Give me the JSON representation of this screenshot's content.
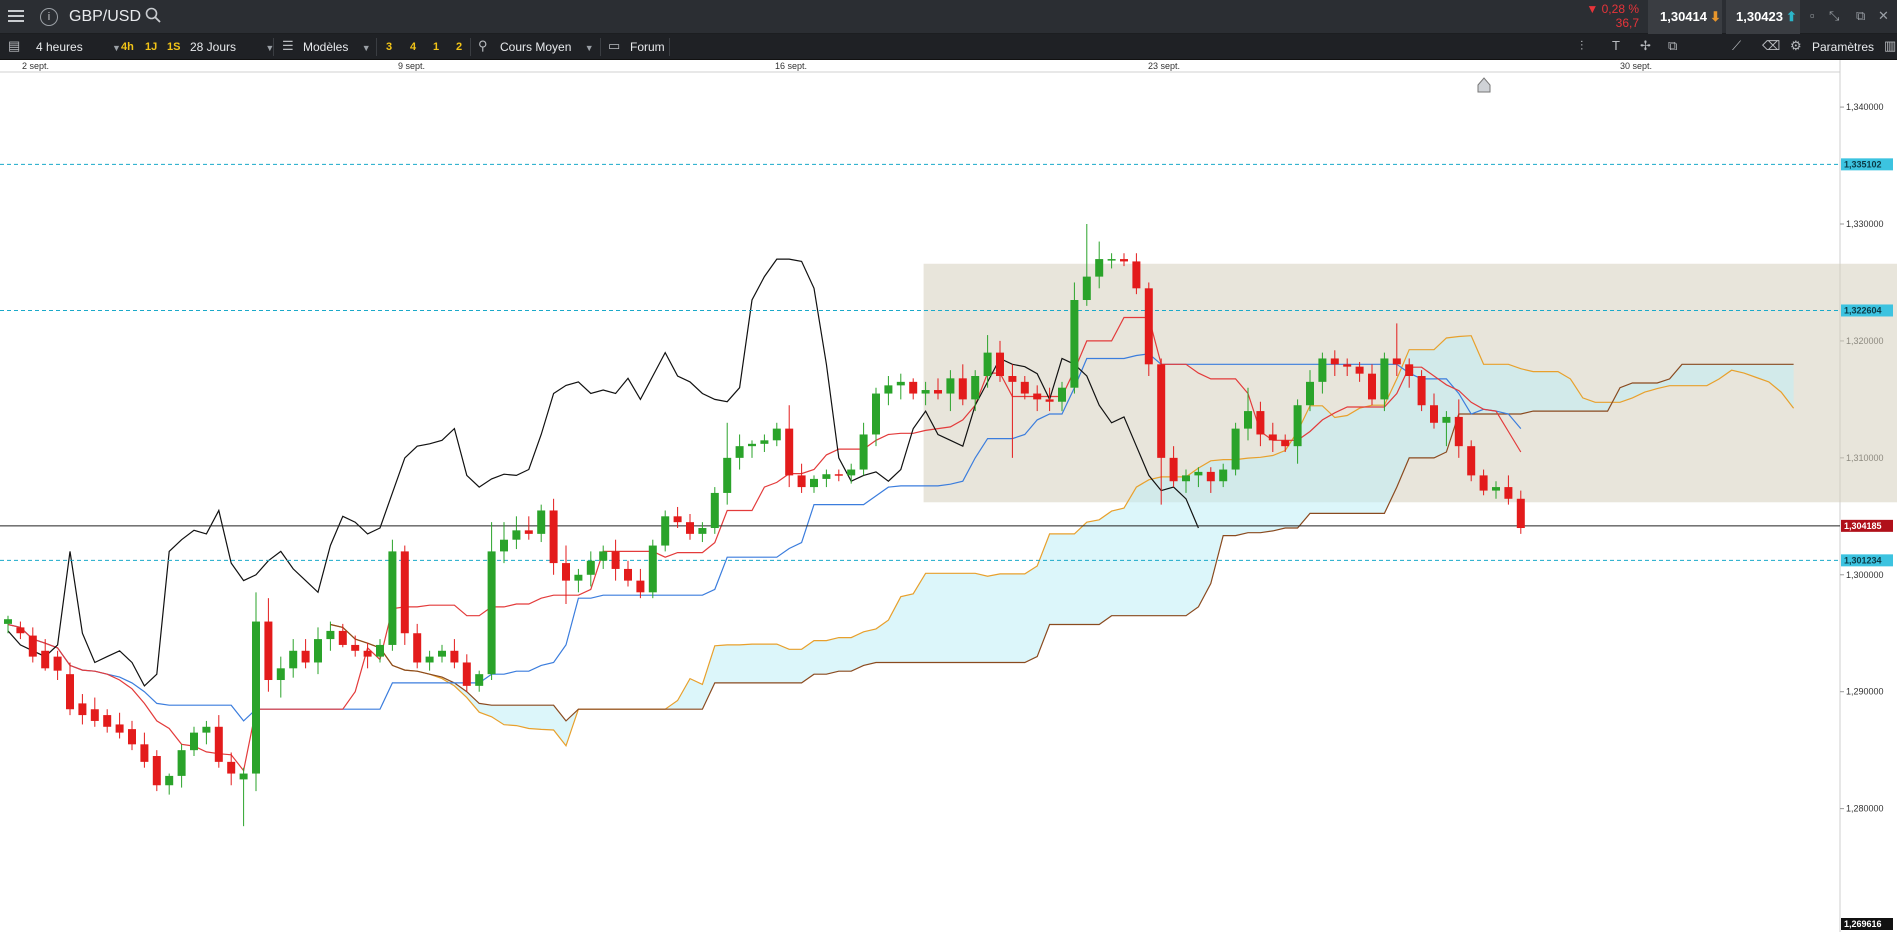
{
  "app": {
    "symbol": "GBP/USD"
  },
  "quote": {
    "change_pct": "▼ 0,28 %",
    "change_pts": "36,7",
    "bid": "1,30414",
    "ask": "1,30423"
  },
  "toolbar": {
    "timeframe": "4 heures",
    "quick_frames": [
      "4h",
      "1J",
      "1S"
    ],
    "range": "28 Jours",
    "models": "Modèles",
    "presets": [
      "3",
      "4",
      "1",
      "2"
    ],
    "price_type": "Cours Moyen",
    "forum": "Forum",
    "settings": "Paramètres"
  },
  "icons": {
    "menu": "hamburger-menu-icon",
    "info": "info-icon",
    "search": "search-icon",
    "bid_trend": "arrow-down-icon",
    "ask_trend": "arrow-up-icon",
    "restore": "restore-icon",
    "collapse": "collapse-icon",
    "popout": "popout-icon",
    "close": "close-icon",
    "settings": "gear-icon",
    "list": "list-icon",
    "chart_type": "candlestick-icon",
    "draw": "draw-line-icon"
  },
  "chart_data": {
    "type": "candlestick",
    "x_ticks": [
      "2 sept.",
      "9 sept.",
      "16 sept.",
      "23 sept.",
      "30 sept."
    ],
    "y_ticks": [
      "1,340000",
      "1,330000",
      "1,320000",
      "1,310000",
      "1,300000",
      "1,290000",
      "1,280000"
    ],
    "ylim": [
      1.26962,
      1.343
    ],
    "levels": [
      {
        "label": "1,335102",
        "value": 1.335102,
        "style": "dashed",
        "color": "#1aa9c9"
      },
      {
        "label": "1,322604",
        "value": 1.322604,
        "style": "dashed",
        "color": "#1aa9c9"
      },
      {
        "label": "1,304185",
        "value": 1.304185,
        "style": "solid",
        "color": "#222222",
        "tag_color": "#b0101a"
      },
      {
        "label": "1,301234",
        "value": 1.301234,
        "style": "dashed",
        "color": "#1aa9c9"
      }
    ],
    "bottom_label": "1,269616",
    "range_box": {
      "from_index": 74,
      "to_index": 176,
      "top": 1.3266,
      "bottom": 1.3062
    },
    "candles": [
      [
        1.2958,
        1.2965,
        1.295,
        1.2962
      ],
      [
        1.2955,
        1.296,
        1.2945,
        1.295
      ],
      [
        1.2948,
        1.2955,
        1.2925,
        1.293
      ],
      [
        1.2935,
        1.2945,
        1.2918,
        1.292
      ],
      [
        1.293,
        1.2935,
        1.291,
        1.2918
      ],
      [
        1.2915,
        1.2925,
        1.288,
        1.2885
      ],
      [
        1.289,
        1.2898,
        1.2872,
        1.288
      ],
      [
        1.2885,
        1.2895,
        1.287,
        1.2875
      ],
      [
        1.288,
        1.2885,
        1.2865,
        1.287
      ],
      [
        1.2872,
        1.2882,
        1.286,
        1.2865
      ],
      [
        1.2868,
        1.2875,
        1.285,
        1.2855
      ],
      [
        1.2855,
        1.2865,
        1.2835,
        1.284
      ],
      [
        1.2845,
        1.285,
        1.2815,
        1.282
      ],
      [
        1.282,
        1.283,
        1.2812,
        1.2828
      ],
      [
        1.2828,
        1.2855,
        1.2818,
        1.285
      ],
      [
        1.285,
        1.287,
        1.2845,
        1.2865
      ],
      [
        1.2865,
        1.2875,
        1.2855,
        1.287
      ],
      [
        1.287,
        1.288,
        1.2835,
        1.284
      ],
      [
        1.284,
        1.2848,
        1.282,
        1.283
      ],
      [
        1.2825,
        1.2835,
        1.2785,
        1.283
      ],
      [
        1.283,
        1.2985,
        1.2815,
        1.296
      ],
      [
        1.296,
        1.298,
        1.29,
        1.291
      ],
      [
        1.291,
        1.293,
        1.2895,
        1.292
      ],
      [
        1.292,
        1.2945,
        1.2912,
        1.2935
      ],
      [
        1.2935,
        1.2945,
        1.292,
        1.2925
      ],
      [
        1.2925,
        1.2955,
        1.2915,
        1.2945
      ],
      [
        1.2945,
        1.296,
        1.2935,
        1.2952
      ],
      [
        1.2952,
        1.2958,
        1.2938,
        1.294
      ],
      [
        1.294,
        1.2948,
        1.293,
        1.2935
      ],
      [
        1.2935,
        1.2942,
        1.292,
        1.293
      ],
      [
        1.293,
        1.2945,
        1.2925,
        1.294
      ],
      [
        1.294,
        1.303,
        1.2935,
        1.302
      ],
      [
        1.302,
        1.3025,
        1.294,
        1.295
      ],
      [
        1.295,
        1.2958,
        1.292,
        1.2925
      ],
      [
        1.2925,
        1.2935,
        1.2918,
        1.293
      ],
      [
        1.293,
        1.294,
        1.2925,
        1.2935
      ],
      [
        1.2935,
        1.2945,
        1.292,
        1.2925
      ],
      [
        1.2925,
        1.2932,
        1.29,
        1.2905
      ],
      [
        1.2905,
        1.2918,
        1.29,
        1.2915
      ],
      [
        1.2915,
        1.3045,
        1.291,
        1.302
      ],
      [
        1.302,
        1.3045,
        1.301,
        1.303
      ],
      [
        1.303,
        1.305,
        1.3022,
        1.3038
      ],
      [
        1.3038,
        1.305,
        1.303,
        1.3035
      ],
      [
        1.3035,
        1.306,
        1.3028,
        1.3055
      ],
      [
        1.3055,
        1.3065,
        1.3,
        1.301
      ],
      [
        1.301,
        1.3025,
        1.2975,
        1.2995
      ],
      [
        1.2995,
        1.3005,
        1.2985,
        1.3
      ],
      [
        1.3,
        1.302,
        1.299,
        1.3012
      ],
      [
        1.3012,
        1.3025,
        1.3005,
        1.302
      ],
      [
        1.302,
        1.303,
        1.2995,
        1.3005
      ],
      [
        1.3005,
        1.3012,
        1.299,
        1.2995
      ],
      [
        1.2995,
        1.3005,
        1.298,
        1.2985
      ],
      [
        1.2985,
        1.303,
        1.298,
        1.3025
      ],
      [
        1.3025,
        1.3055,
        1.302,
        1.305
      ],
      [
        1.305,
        1.3058,
        1.304,
        1.3045
      ],
      [
        1.3045,
        1.3052,
        1.303,
        1.3035
      ],
      [
        1.3035,
        1.3045,
        1.3028,
        1.304
      ],
      [
        1.304,
        1.3075,
        1.3035,
        1.307
      ],
      [
        1.307,
        1.313,
        1.306,
        1.31
      ],
      [
        1.31,
        1.312,
        1.309,
        1.311
      ],
      [
        1.311,
        1.3115,
        1.31,
        1.3112
      ],
      [
        1.3112,
        1.312,
        1.3105,
        1.3115
      ],
      [
        1.3115,
        1.313,
        1.311,
        1.3125
      ],
      [
        1.3125,
        1.3145,
        1.3075,
        1.3085
      ],
      [
        1.3085,
        1.3095,
        1.307,
        1.3075
      ],
      [
        1.3075,
        1.3085,
        1.307,
        1.3082
      ],
      [
        1.3082,
        1.309,
        1.3075,
        1.3086
      ],
      [
        1.3086,
        1.309,
        1.308,
        1.3085
      ],
      [
        1.3085,
        1.3095,
        1.3078,
        1.309
      ],
      [
        1.309,
        1.313,
        1.3085,
        1.312
      ],
      [
        1.312,
        1.316,
        1.311,
        1.3155
      ],
      [
        1.3155,
        1.317,
        1.3145,
        1.3162
      ],
      [
        1.3162,
        1.3172,
        1.315,
        1.3165
      ],
      [
        1.3165,
        1.3168,
        1.315,
        1.3155
      ],
      [
        1.3155,
        1.3165,
        1.3145,
        1.3158
      ],
      [
        1.3158,
        1.3168,
        1.315,
        1.3155
      ],
      [
        1.3155,
        1.3175,
        1.314,
        1.3168
      ],
      [
        1.3168,
        1.318,
        1.3145,
        1.315
      ],
      [
        1.315,
        1.3175,
        1.314,
        1.317
      ],
      [
        1.317,
        1.3205,
        1.316,
        1.319
      ],
      [
        1.319,
        1.32,
        1.3165,
        1.317
      ],
      [
        1.317,
        1.318,
        1.31,
        1.3165
      ],
      [
        1.3165,
        1.317,
        1.315,
        1.3155
      ],
      [
        1.3155,
        1.3162,
        1.314,
        1.315
      ],
      [
        1.315,
        1.316,
        1.314,
        1.3148
      ],
      [
        1.3148,
        1.3165,
        1.314,
        1.316
      ],
      [
        1.316,
        1.325,
        1.3155,
        1.3235
      ],
      [
        1.3235,
        1.33,
        1.323,
        1.3255
      ],
      [
        1.3255,
        1.3285,
        1.3245,
        1.327
      ],
      [
        1.327,
        1.3275,
        1.3262,
        1.327
      ],
      [
        1.327,
        1.3275,
        1.3264,
        1.3268
      ],
      [
        1.3268,
        1.3275,
        1.324,
        1.3245
      ],
      [
        1.3245,
        1.325,
        1.317,
        1.318
      ],
      [
        1.318,
        1.3185,
        1.306,
        1.31
      ],
      [
        1.31,
        1.311,
        1.3075,
        1.308
      ],
      [
        1.308,
        1.309,
        1.307,
        1.3085
      ],
      [
        1.3085,
        1.3092,
        1.3075,
        1.3088
      ],
      [
        1.3088,
        1.3092,
        1.307,
        1.308
      ],
      [
        1.308,
        1.3095,
        1.3075,
        1.309
      ],
      [
        1.309,
        1.313,
        1.3085,
        1.3125
      ],
      [
        1.3125,
        1.316,
        1.3115,
        1.314
      ],
      [
        1.314,
        1.3148,
        1.311,
        1.312
      ],
      [
        1.312,
        1.313,
        1.3105,
        1.3115
      ],
      [
        1.3115,
        1.312,
        1.3105,
        1.311
      ],
      [
        1.311,
        1.315,
        1.3095,
        1.3145
      ],
      [
        1.3145,
        1.3175,
        1.314,
        1.3165
      ],
      [
        1.3165,
        1.319,
        1.3155,
        1.3185
      ],
      [
        1.3185,
        1.3192,
        1.317,
        1.318
      ],
      [
        1.318,
        1.3185,
        1.317,
        1.3178
      ],
      [
        1.3178,
        1.3182,
        1.3165,
        1.3172
      ],
      [
        1.3172,
        1.318,
        1.3145,
        1.315
      ],
      [
        1.315,
        1.319,
        1.314,
        1.3185
      ],
      [
        1.3185,
        1.3215,
        1.317,
        1.318
      ],
      [
        1.318,
        1.3185,
        1.316,
        1.317
      ],
      [
        1.317,
        1.3175,
        1.314,
        1.3145
      ],
      [
        1.3145,
        1.3155,
        1.3125,
        1.313
      ],
      [
        1.313,
        1.314,
        1.311,
        1.3135
      ],
      [
        1.3135,
        1.315,
        1.31,
        1.311
      ],
      [
        1.311,
        1.3115,
        1.308,
        1.3085
      ],
      [
        1.3085,
        1.309,
        1.3068,
        1.3072
      ],
      [
        1.3072,
        1.308,
        1.3065,
        1.3075
      ],
      [
        1.3075,
        1.3085,
        1.306,
        1.3065
      ],
      [
        1.3065,
        1.3072,
        1.3035,
        1.304
      ]
    ],
    "indicators": [
      {
        "name": "Chikou",
        "color": "#111111"
      },
      {
        "name": "Tenkan",
        "color": "#e33b3b"
      },
      {
        "name": "Kijun",
        "color": "#3b7ddd"
      },
      {
        "name": "Senkou A",
        "color": "#e8a02c"
      },
      {
        "name": "Senkou B",
        "color": "#8a4a1f"
      }
    ]
  }
}
